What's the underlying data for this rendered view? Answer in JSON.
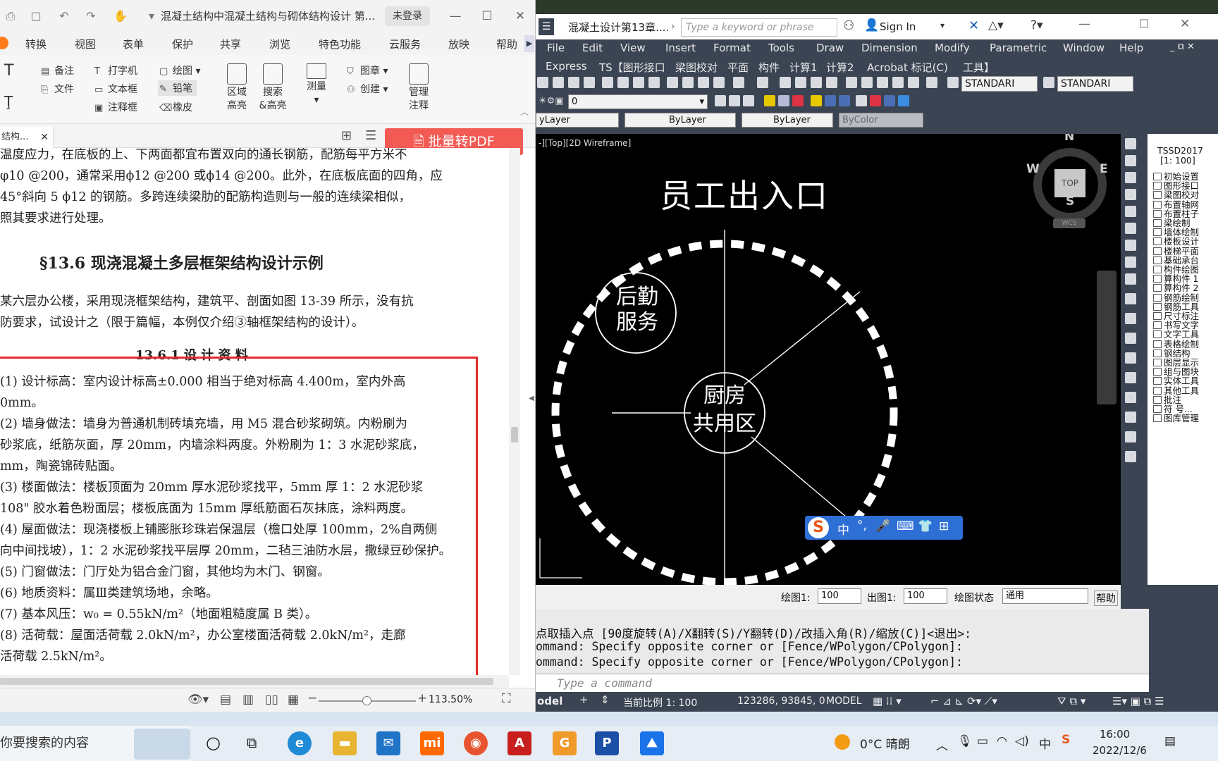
{
  "pdf": {
    "title": "混凝土结构中混凝土结构与砌体结构设计 第...",
    "login": "未登录",
    "menu": [
      "转换",
      "视图",
      "表单",
      "保护",
      "共享",
      "浏览",
      "特色功能",
      "云服务",
      "放映",
      "帮助"
    ],
    "ribbon": {
      "note": "备注",
      "file": "文件",
      "typewriter": "打字机",
      "textbox": "文本框",
      "callout": "注释框",
      "draw": "绘图",
      "pencil": "铅笔",
      "eraser": "橡皮",
      "area_highlight": "区域\n高亮",
      "search_highlight": "搜索\n&高亮",
      "measure": "测量",
      "stamp": "图章",
      "create": "创建",
      "manage_notes": "管理\n注释"
    },
    "doc_tab": "结构...",
    "batch_pdf_button": "批量转PDF",
    "page_lines": [
      "温度应力，在底板的上、下两面都宜布置双向的通长钢筋，配筋每平方米不",
      "φ10 @200，通常采用ϕ12 @200 或ϕ14 @200。此外，在底板底面的四角，应",
      "45°斜向 5 ϕ12 的钢筋。多跨连续梁肋的配筋构造则与一般的连续梁相似，",
      "照其要求进行处理。"
    ],
    "section_heading": "§13.6   现浇混凝土多层框架结构设计示例",
    "intro_lines": [
      "某六层办公楼，采用现浇框架结构，建筑平、剖面如图 13-39 所示，没有抗",
      "防要求，试设计之（限于篇幅，本例仅介绍③轴框架结构的设计）。"
    ],
    "subheading": "13.6.1   设  计  资  料",
    "boxed_lines": [
      "(1) 设计标高：室内设计标高±0.000 相当于绝对标高 4.400m，室内外高",
      "0mm。",
      "(2) 墙身做法：墙身为普通机制砖填充墙，用 M5 混合砂浆砌筑。内粉刷为",
      "砂浆底，纸筋灰面，厚 20mm，内墙涂料两度。外粉刷为 1：3 水泥砂浆底，",
      "mm，陶瓷锦砖贴面。",
      "(3) 楼面做法：楼板顶面为 20mm 厚水泥砂浆找平，5mm 厚 1：2 水泥砂浆",
      "108\" 胶水着色粉面层；楼板底面为 15mm 厚纸筋面石灰抹底，涂料两度。",
      "(4) 屋面做法：现浇楼板上铺膨胀珍珠岩保温层（檐口处厚 100mm，2%自两侧",
      "向中间找坡），1：2 水泥砂浆找平层厚 20mm，二毡三油防水层，撒绿豆砂保护。",
      "(5) 门窗做法：门厅处为铝合金门窗，其他均为木门、钢窗。",
      "(6) 地质资料：属Ⅲ类建筑场地，余略。",
      "(7) 基本风压：w₀ = 0.55kN/m²（地面粗糙度属 B 类）。",
      "(8) 活荷载：屋面活荷载 2.0kN/m²，办公室楼面活荷载 2.0kN/m²，走廊",
      "活荷载 2.5kN/m²。"
    ],
    "zoom": "113.50%"
  },
  "cad": {
    "title": "混凝土设计第13章....",
    "search_placeholder": "Type a keyword or phrase",
    "sign_in": "Sign In",
    "menu": [
      "File",
      "Edit",
      "View",
      "Insert",
      "Format",
      "Tools",
      "Draw",
      "Dimension",
      "Modify",
      "Parametric",
      "Window",
      "Help"
    ],
    "menu2": [
      "Express",
      "TS【图形接口",
      "梁图校对",
      "平面",
      "构件",
      "计算1",
      "计算2",
      "Acrobat 标记(C)",
      "工具】"
    ],
    "standard1": "STANDARI",
    "standard2": "STANDARI",
    "layer_value": "0",
    "props": [
      "yLayer",
      "ByLayer",
      "ByLayer",
      "ByColor"
    ],
    "viewport_label": "-][Top][2D Wireframe]",
    "drawing_title": "员工出入口",
    "circle1_line1": "后勤",
    "circle1_line2": "服务",
    "circle2_line1": "厨房",
    "circle2_line2": "共用区",
    "viewcube": {
      "n": "N",
      "s": "S",
      "e": "E",
      "w": "W",
      "top": "TOP",
      "wcs": "WCS"
    },
    "scalebar": {
      "label1": "绘图1:",
      "val1": "100",
      "label2": "出图1:",
      "val2": "100",
      "label3": "绘图状态",
      "val3": "通用",
      "help": "帮助"
    },
    "cmd_lines": [
      "点取插入点 [90度旋转(A)/X翻转(S)/Y翻转(D)/改插入角(R)/缩放(C)]<退出>:",
      "ommand: Specify opposite corner or [Fence/WPolygon/CPolygon]:",
      "ommand: Specify opposite corner or [Fence/WPolygon/CPolygon]:"
    ],
    "cmd_placeholder": "Type a command",
    "status": {
      "tab": "odel",
      "scale": "当前比例 1: 100",
      "coords": "123286, 93845, 0",
      "mode": "MODEL"
    },
    "tssd": {
      "header": "TSSD2017",
      "scale": "[1: 100]",
      "items": [
        "初始设置",
        "图形接口",
        "梁图校对",
        "布置轴网",
        "布置柱子",
        "梁绘制",
        "墙体绘制",
        "楼板设计",
        "楼梯平面",
        "基础承台",
        "构件绘图",
        "算构件 1",
        "算构件 2",
        "钢筋绘制",
        "钢筋工具",
        "尺寸标注",
        "书写文字",
        "文字工具",
        "表格绘制",
        "钢结构",
        "图层显示",
        "组与图块",
        "实体工具",
        "其他工具",
        "批注",
        "符 号...",
        "图库管理"
      ]
    },
    "ime": {
      "mode": "中"
    }
  },
  "taskbar": {
    "search": "你要搜索的内容",
    "weather": "0°C 晴朗",
    "ime": "中",
    "time": "16:00",
    "date": "2022/12/6"
  },
  "colors": {
    "accent_red": "#e32b2b",
    "batch_red": "#f25a54",
    "cad_bg": "#000000",
    "cad_ui": "#3b4453"
  }
}
